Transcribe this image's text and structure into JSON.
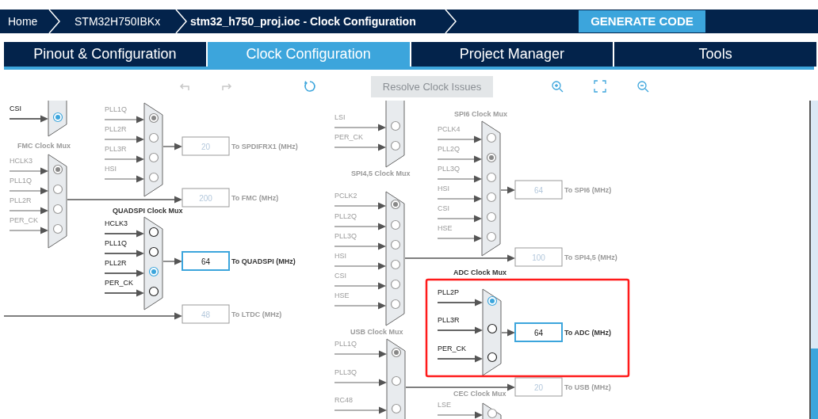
{
  "breadcrumbs": [
    {
      "label": "Home",
      "current": false
    },
    {
      "label": "STM32H750IBKx",
      "current": false
    },
    {
      "label": "stm32_h750_proj.ioc - Clock Configuration",
      "current": true
    }
  ],
  "generate_button": "GENERATE CODE",
  "tabs": [
    {
      "label": "Pinout & Configuration",
      "selected": false
    },
    {
      "label": "Clock Configuration",
      "selected": true
    },
    {
      "label": "Project Manager",
      "selected": false
    },
    {
      "label": "Tools",
      "selected": false
    }
  ],
  "toolbar": {
    "resolve_button": "Resolve Clock Issues",
    "resolve_disabled": true
  },
  "muxes": [
    {
      "kind": "mux",
      "active": true,
      "inputs": [
        {
          "label": "CSI",
          "selected": true
        }
      ]
    },
    {
      "kind": "mux",
      "active": false,
      "inputs": [
        {
          "label": "PLL1Q",
          "selected": true
        },
        {
          "label": "PLL2R",
          "selected": false
        },
        {
          "label": "PLL3R",
          "selected": false
        },
        {
          "label": "HSI",
          "selected": false
        }
      ],
      "output": {
        "value": "20",
        "label": "To SPDIFRX1 (MHz)"
      }
    },
    {
      "kind": "mux",
      "title": "FMC Clock Mux",
      "active": false,
      "inputs": [
        {
          "label": "HCLK3",
          "selected": true
        },
        {
          "label": "PLL1Q",
          "selected": false
        },
        {
          "label": "PLL2R",
          "selected": false
        },
        {
          "label": "PER_CK",
          "selected": false
        }
      ],
      "output": {
        "value": "200",
        "label": "To FMC (MHz)"
      }
    },
    {
      "kind": "mux",
      "title": "QUADSPI Clock Mux",
      "active": true,
      "inputs": [
        {
          "label": "HCLK3",
          "selected": false
        },
        {
          "label": "PLL1Q",
          "selected": false
        },
        {
          "label": "PLL2R",
          "selected": true
        },
        {
          "label": "PER_CK",
          "selected": false
        }
      ],
      "output": {
        "value": "64",
        "label": "To QUADSPI (MHz)"
      }
    },
    {
      "kind": "wire",
      "active": false,
      "output": {
        "value": "48",
        "label": "To LTDC (MHz)"
      }
    },
    {
      "kind": "mux",
      "active": false,
      "inputs": [
        {
          "label": "LSI",
          "selected": false
        },
        {
          "label": "PER_CK",
          "selected": false
        }
      ]
    },
    {
      "kind": "mux",
      "title": "SPI6 Clock Mux",
      "active": false,
      "inputs": [
        {
          "label": "PCLK4",
          "selected": false
        },
        {
          "label": "PLL2Q",
          "selected": true
        },
        {
          "label": "PLL3Q",
          "selected": false
        },
        {
          "label": "HSI",
          "selected": false
        },
        {
          "label": "CSI",
          "selected": false
        },
        {
          "label": "HSE",
          "selected": false
        }
      ],
      "output": {
        "value": "64",
        "label": "To SPI6 (MHz)"
      }
    },
    {
      "kind": "mux",
      "title": "SPI4,5 Clock Mux",
      "active": false,
      "inputs": [
        {
          "label": "PCLK2",
          "selected": true
        },
        {
          "label": "PLL2Q",
          "selected": false
        },
        {
          "label": "PLL3Q",
          "selected": false
        },
        {
          "label": "HSI",
          "selected": false
        },
        {
          "label": "CSI",
          "selected": false
        },
        {
          "label": "HSE",
          "selected": false
        }
      ],
      "output": {
        "value": "100",
        "label": "To SPI4,5 (MHz)"
      }
    },
    {
      "kind": "mux",
      "title": "ADC Clock Mux",
      "active": true,
      "highlighted": true,
      "inputs": [
        {
          "label": "PLL2P",
          "selected": true
        },
        {
          "label": "PLL3R",
          "selected": false
        },
        {
          "label": "PER_CK",
          "selected": false
        }
      ],
      "output": {
        "value": "64",
        "label": "To ADC (MHz)"
      }
    },
    {
      "kind": "mux",
      "title": "USB Clock Mux",
      "active": false,
      "inputs": [
        {
          "label": "PLL1Q",
          "selected": true
        },
        {
          "label": "PLL3Q",
          "selected": false
        },
        {
          "label": "RC48",
          "selected": false
        }
      ],
      "output": {
        "value": "20",
        "label": "To USB (MHz)"
      }
    },
    {
      "kind": "mux",
      "title": "CEC Clock Mux",
      "active": false,
      "inputs": [
        {
          "label": "LSE",
          "selected": false
        }
      ]
    }
  ]
}
